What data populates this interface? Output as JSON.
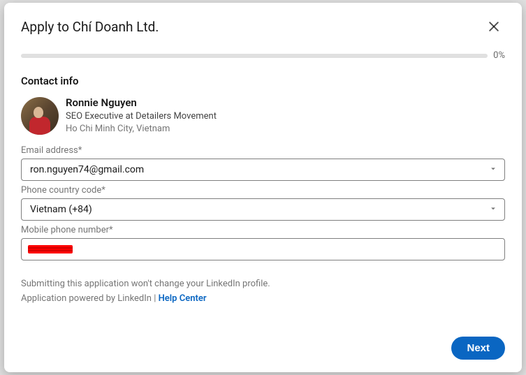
{
  "modal": {
    "title": "Apply to Chí Doanh Ltd.",
    "progress": "0%"
  },
  "section": {
    "heading": "Contact info"
  },
  "profile": {
    "name": "Ronnie Nguyen",
    "headline": "SEO Executive at Detailers Movement",
    "location": "Ho Chi Minh City, Vietnam"
  },
  "fields": {
    "email": {
      "label": "Email address*",
      "value": "ron.nguyen74@gmail.com"
    },
    "country_code": {
      "label": "Phone country code*",
      "value": "Vietnam (+84)"
    },
    "phone": {
      "label": "Mobile phone number*",
      "value": ""
    }
  },
  "disclaimer": {
    "line1": "Submitting this application won't change your LinkedIn profile.",
    "line2_prefix": "Application powered by LinkedIn | ",
    "help_link": "Help Center"
  },
  "footer": {
    "next": "Next"
  }
}
